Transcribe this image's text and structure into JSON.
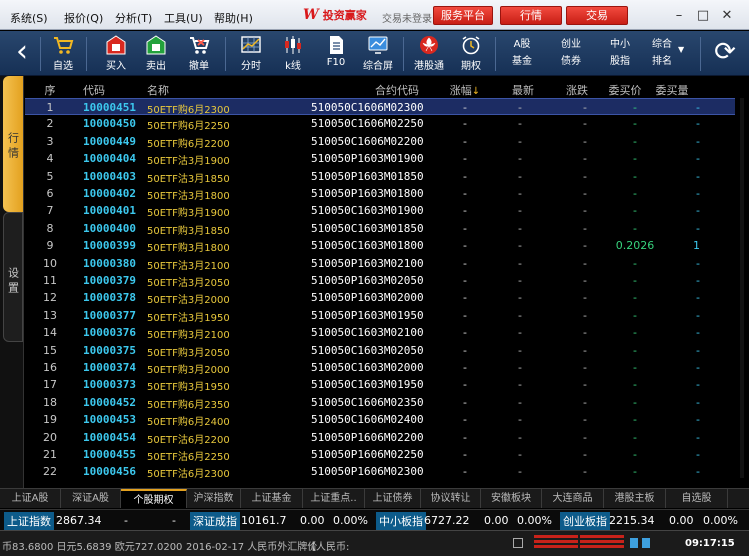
{
  "menu": [
    "系统(S)",
    "报价(Q)",
    "分析(T)",
    "工具(U)",
    "帮助(H)"
  ],
  "brand": {
    "logo_mark": "W",
    "name": "投资赢家"
  },
  "login_status": "交易未登录",
  "top_buttons": [
    "服务平台",
    "行情",
    "交易"
  ],
  "window_controls": {
    "minimize": "–",
    "maximize": "□",
    "close": "✕"
  },
  "toolbar": {
    "back": "‹",
    "buttons": [
      "自选",
      "买入",
      "卖出",
      "撤单",
      "分时",
      "k线",
      "F10",
      "综合屏",
      "港股通",
      "期权"
    ],
    "text_buttons": [
      {
        "line1": "A股",
        "line2": "基金"
      },
      {
        "line1": "创业",
        "line2": "债券"
      },
      {
        "line1": "中小",
        "line2": "股指"
      }
    ],
    "ranking": {
      "line1": "综合",
      "line2": "排名",
      "arrow": "▼"
    },
    "refresh": "⟳"
  },
  "side_tabs": [
    "行情",
    "设置"
  ],
  "table": {
    "columns": {
      "seq": "序",
      "code": "代码",
      "name": "名称",
      "contract": "合约代码",
      "change_pct": "涨幅",
      "sort_arrow": "↓",
      "last": "最新",
      "change": "涨跌",
      "bid": "委买价",
      "bid_vol": "委买量"
    },
    "rows": [
      {
        "seq": "1",
        "code": "10000451",
        "name": "50ETF购6月2300",
        "contract": "510050C1606M02300",
        "change_pct": "-",
        "last": "-",
        "change": "-",
        "bid": "-",
        "bid_vol": "-"
      },
      {
        "seq": "2",
        "code": "10000450",
        "name": "50ETF购6月2250",
        "contract": "510050C1606M02250",
        "change_pct": "-",
        "last": "-",
        "change": "-",
        "bid": "-",
        "bid_vol": "-"
      },
      {
        "seq": "3",
        "code": "10000449",
        "name": "50ETF购6月2200",
        "contract": "510050C1606M02200",
        "change_pct": "-",
        "last": "-",
        "change": "-",
        "bid": "-",
        "bid_vol": "-"
      },
      {
        "seq": "4",
        "code": "10000404",
        "name": "50ETF沽3月1900",
        "contract": "510050P1603M01900",
        "change_pct": "-",
        "last": "-",
        "change": "-",
        "bid": "-",
        "bid_vol": "-"
      },
      {
        "seq": "5",
        "code": "10000403",
        "name": "50ETF沽3月1850",
        "contract": "510050P1603M01850",
        "change_pct": "-",
        "last": "-",
        "change": "-",
        "bid": "-",
        "bid_vol": "-"
      },
      {
        "seq": "6",
        "code": "10000402",
        "name": "50ETF沽3月1800",
        "contract": "510050P1603M01800",
        "change_pct": "-",
        "last": "-",
        "change": "-",
        "bid": "-",
        "bid_vol": "-"
      },
      {
        "seq": "7",
        "code": "10000401",
        "name": "50ETF购3月1900",
        "contract": "510050C1603M01900",
        "change_pct": "-",
        "last": "-",
        "change": "-",
        "bid": "-",
        "bid_vol": "-"
      },
      {
        "seq": "8",
        "code": "10000400",
        "name": "50ETF购3月1850",
        "contract": "510050C1603M01850",
        "change_pct": "-",
        "last": "-",
        "change": "-",
        "bid": "-",
        "bid_vol": "-"
      },
      {
        "seq": "9",
        "code": "10000399",
        "name": "50ETF购3月1800",
        "contract": "510050C1603M01800",
        "change_pct": "-",
        "last": "-",
        "change": "-",
        "bid": "0.2026",
        "bid_vol": "1"
      },
      {
        "seq": "10",
        "code": "10000380",
        "name": "50ETF沽3月2100",
        "contract": "510050P1603M02100",
        "change_pct": "-",
        "last": "-",
        "change": "-",
        "bid": "-",
        "bid_vol": "-"
      },
      {
        "seq": "11",
        "code": "10000379",
        "name": "50ETF沽3月2050",
        "contract": "510050P1603M02050",
        "change_pct": "-",
        "last": "-",
        "change": "-",
        "bid": "-",
        "bid_vol": "-"
      },
      {
        "seq": "12",
        "code": "10000378",
        "name": "50ETF沽3月2000",
        "contract": "510050P1603M02000",
        "change_pct": "-",
        "last": "-",
        "change": "-",
        "bid": "-",
        "bid_vol": "-"
      },
      {
        "seq": "13",
        "code": "10000377",
        "name": "50ETF沽3月1950",
        "contract": "510050P1603M01950",
        "change_pct": "-",
        "last": "-",
        "change": "-",
        "bid": "-",
        "bid_vol": "-"
      },
      {
        "seq": "14",
        "code": "10000376",
        "name": "50ETF购3月2100",
        "contract": "510050C1603M02100",
        "change_pct": "-",
        "last": "-",
        "change": "-",
        "bid": "-",
        "bid_vol": "-"
      },
      {
        "seq": "15",
        "code": "10000375",
        "name": "50ETF购3月2050",
        "contract": "510050C1603M02050",
        "change_pct": "-",
        "last": "-",
        "change": "-",
        "bid": "-",
        "bid_vol": "-"
      },
      {
        "seq": "16",
        "code": "10000374",
        "name": "50ETF购3月2000",
        "contract": "510050C1603M02000",
        "change_pct": "-",
        "last": "-",
        "change": "-",
        "bid": "-",
        "bid_vol": "-"
      },
      {
        "seq": "17",
        "code": "10000373",
        "name": "50ETF购3月1950",
        "contract": "510050C1603M01950",
        "change_pct": "-",
        "last": "-",
        "change": "-",
        "bid": "-",
        "bid_vol": "-"
      },
      {
        "seq": "18",
        "code": "10000452",
        "name": "50ETF购6月2350",
        "contract": "510050C1606M02350",
        "change_pct": "-",
        "last": "-",
        "change": "-",
        "bid": "-",
        "bid_vol": "-"
      },
      {
        "seq": "19",
        "code": "10000453",
        "name": "50ETF购6月2400",
        "contract": "510050C1606M02400",
        "change_pct": "-",
        "last": "-",
        "change": "-",
        "bid": "-",
        "bid_vol": "-"
      },
      {
        "seq": "20",
        "code": "10000454",
        "name": "50ETF沽6月2200",
        "contract": "510050P1606M02200",
        "change_pct": "-",
        "last": "-",
        "change": "-",
        "bid": "-",
        "bid_vol": "-"
      },
      {
        "seq": "21",
        "code": "10000455",
        "name": "50ETF沽6月2250",
        "contract": "510050P1606M02250",
        "change_pct": "-",
        "last": "-",
        "change": "-",
        "bid": "-",
        "bid_vol": "-"
      },
      {
        "seq": "22",
        "code": "10000456",
        "name": "50ETF沽6月2300",
        "contract": "510050P1606M02300",
        "change_pct": "-",
        "last": "-",
        "change": "-",
        "bid": "-",
        "bid_vol": "-"
      }
    ]
  },
  "bottom_tabs": [
    "上证A股",
    "深证A股",
    "个股期权",
    "沪深指数",
    "上证基金",
    "上证重点..",
    "上证债券",
    "协议转让",
    "安徽板块",
    "大连商品",
    "港股主板",
    "自选股"
  ],
  "index_bar": {
    "sh": {
      "label": "上证指数",
      "value": "2867.34",
      "a": "-",
      "b": "-"
    },
    "sz": {
      "label": "深证成指",
      "value": "10161.7",
      "a": "0.00",
      "b": "0.00%"
    },
    "sme": {
      "label": "中小板指",
      "value": "6727.22",
      "a": "0.00",
      "b": "0.00%"
    },
    "gem": {
      "label": "创业板指",
      "value": "2215.34",
      "a": "0.00",
      "b": "0.00%"
    }
  },
  "status_bar": {
    "fx": "币83.6800 日元5.6839 欧元727.0200",
    "notice": "2016-02-17 人民币外汇牌价",
    "notice2": "【人民币:",
    "time": "09:17:15"
  },
  "colors": {
    "accent": "#e3a11f",
    "brand_red": "#d8181b",
    "code_cyan": "#3cc8ee",
    "name_yellow": "#e8c83c",
    "bid_green": "#37d27d"
  }
}
